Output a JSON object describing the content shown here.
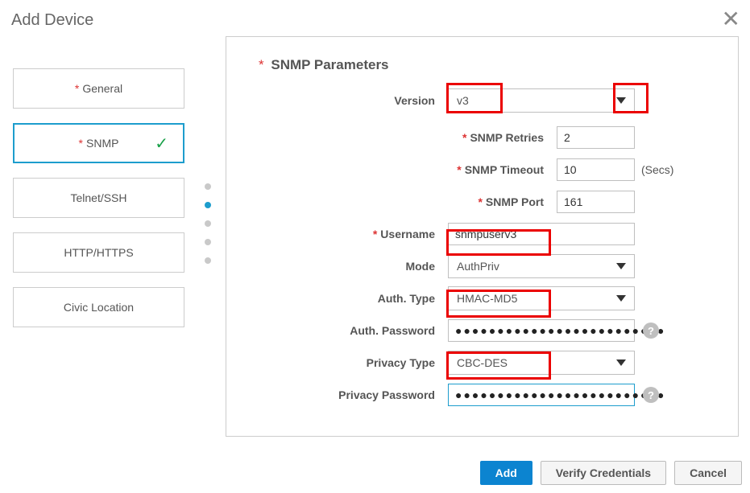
{
  "title": "Add Device",
  "sidebar": {
    "tabs": [
      {
        "label": "General",
        "required": true,
        "active": false,
        "checked": false
      },
      {
        "label": "SNMP",
        "required": true,
        "active": true,
        "checked": true
      },
      {
        "label": "Telnet/SSH",
        "required": false,
        "active": false,
        "checked": false
      },
      {
        "label": "HTTP/HTTPS",
        "required": false,
        "active": false,
        "checked": false
      },
      {
        "label": "Civic Location",
        "required": false,
        "active": false,
        "checked": false
      }
    ]
  },
  "panel": {
    "heading": "SNMP Parameters",
    "version": {
      "label": "Version",
      "value": "v3"
    },
    "retries": {
      "label": "SNMP Retries",
      "value": "2"
    },
    "timeout": {
      "label": "SNMP Timeout",
      "value": "10",
      "suffix": "(Secs)"
    },
    "port": {
      "label": "SNMP Port",
      "value": "161"
    },
    "username": {
      "label": "Username",
      "value": "snmpuserv3"
    },
    "mode": {
      "label": "Mode",
      "value": "AuthPriv"
    },
    "authtype": {
      "label": "Auth. Type",
      "value": "HMAC-MD5"
    },
    "authpw": {
      "label": "Auth. Password",
      "value": "●●●●●●●●●●●●●●●●●●●●●●●●●"
    },
    "privtype": {
      "label": "Privacy Type",
      "value": "CBC-DES"
    },
    "privpw": {
      "label": "Privacy Password",
      "value": "●●●●●●●●●●●●●●●●●●●●●●●●●"
    }
  },
  "footer": {
    "add": "Add",
    "verify": "Verify Credentials",
    "cancel": "Cancel"
  }
}
